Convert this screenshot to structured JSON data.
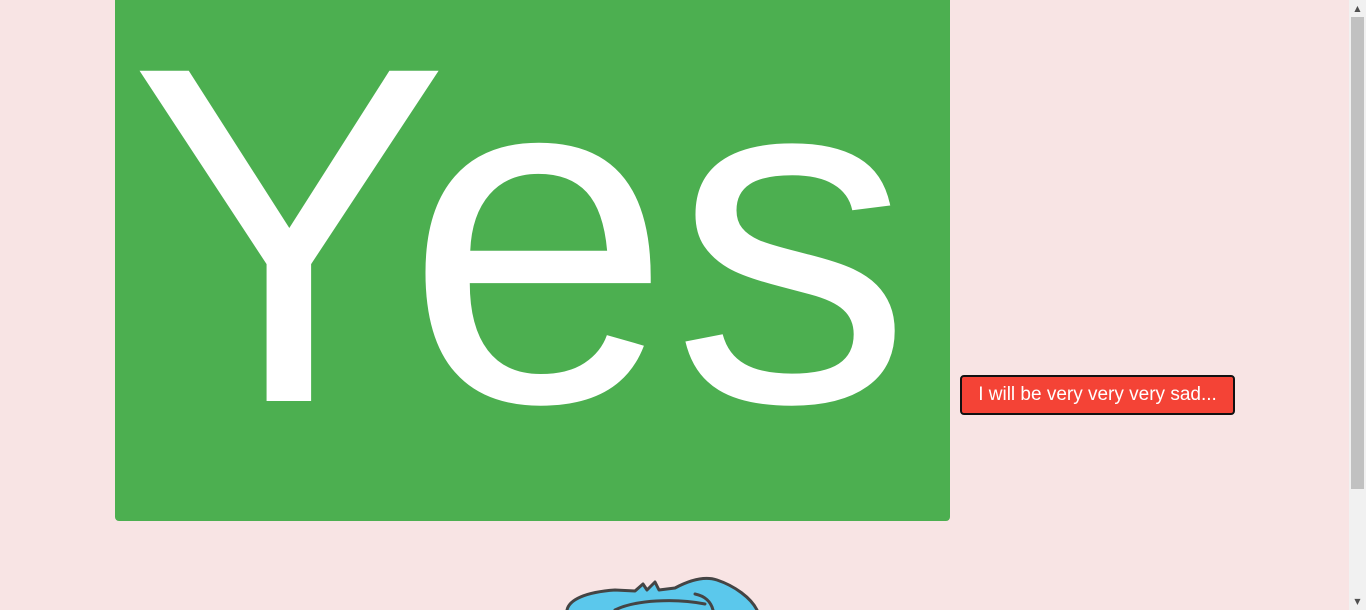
{
  "yes_button": {
    "label": "Yes",
    "color": "#4caf50"
  },
  "no_button": {
    "label": "I will be very very very sad...",
    "color": "#f44336"
  },
  "background_color": "#f8e4e4",
  "mascot": {
    "icon": "cartoon-character-head",
    "color": "#5bc8ec"
  },
  "scrollbar": {
    "up_icon": "triangle-up",
    "down_icon": "triangle-down"
  }
}
